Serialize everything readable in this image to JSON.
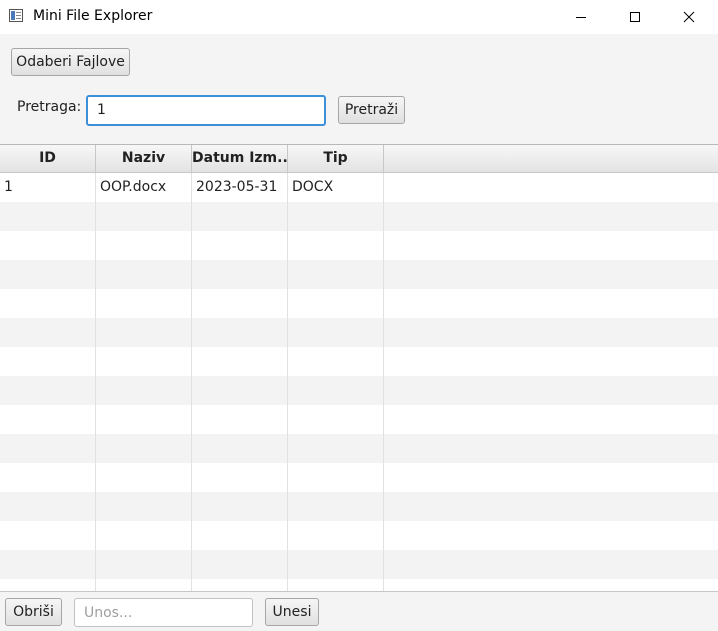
{
  "window": {
    "title": "Mini File Explorer",
    "icon": "app-window-icon",
    "controls": [
      "minimize-icon",
      "maximize-icon",
      "close-icon"
    ]
  },
  "toolbar": {
    "choose_files_label": "Odaberi Fajlove",
    "search_label": "Pretraga:",
    "search_value": "1",
    "search_button_label": "Pretraži"
  },
  "table": {
    "columns": [
      "ID",
      "Naziv",
      "Datum Izm...",
      "Tip"
    ],
    "rows": [
      [
        "1",
        "OOP.docx",
        "2023-05-31",
        "DOCX"
      ]
    ]
  },
  "bottom": {
    "delete_label": "Obriši",
    "entry_placeholder": "Unos...",
    "enter_label": "Unesi"
  },
  "colors": {
    "focus_border": "#3d8fd8",
    "alt_row": "#f3f3f3"
  }
}
